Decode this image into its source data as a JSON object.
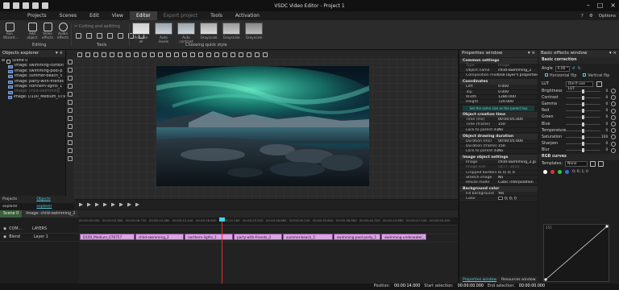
{
  "app": {
    "title": "VSDC Video Editor - Project 1",
    "options_label": "Options"
  },
  "menu": {
    "items": [
      "Projects",
      "Scenes",
      "Edit",
      "View",
      "Editor",
      "Export project",
      "Tools",
      "Activation"
    ],
    "active_index": 4
  },
  "ribbon": {
    "buttons": [
      {
        "label": "Run Wizard...",
        "icon": "wand-icon"
      },
      {
        "label": "Add object",
        "icon": "add-icon"
      },
      {
        "label": "Video effects",
        "icon": "film-icon"
      },
      {
        "label": "Audio effects",
        "icon": "headphones-icon"
      }
    ],
    "editing_group": "Editing",
    "tools_group": "Tools",
    "cutting_label": "Cutting and splitting",
    "quick_style_group": "Choosing quick style",
    "quick_styles": [
      "Remove all",
      "Auto levels",
      "Auto contrast",
      "Grayscale",
      "Grayscale",
      "Grayscale"
    ]
  },
  "objects_explorer": {
    "title": "Objects explorer",
    "scene": "Scene 0",
    "items": [
      {
        "label": "Image: swimming-cordon",
        "faded": false
      },
      {
        "label": "Image: swimming-pool-p",
        "faded": false
      },
      {
        "label": "Image: summer-beach_5",
        "faded": false
      },
      {
        "label": "Image: party-with-friends",
        "faded": false
      },
      {
        "label": "Image: northern-lights_1",
        "faded": false
      },
      {
        "label": "Image: child-swimming",
        "faded": true
      },
      {
        "label": "Image: D100_Medium_079",
        "faded": false
      }
    ],
    "tabs": [
      "Projects explorer",
      "Objects explorer"
    ]
  },
  "properties": {
    "title": "Properties window",
    "common_settings": "Common settings",
    "col_type": "Type",
    "col_image": "Image",
    "object_name_label": "Object name",
    "object_name": "child-swimming_2",
    "composition_label": "Composition mode",
    "composition": "Use layer's properties",
    "coordinates": "Coordinates",
    "left_label": "Left",
    "left": "0.000",
    "top_label": "Top",
    "top": "0.000",
    "width_label": "Width",
    "width": "1280.000",
    "height_label": "Height",
    "height": "720.000",
    "hint": "Set the same size as the parent has",
    "creation_time": "Object creation time",
    "time_ms_label": "Time (ms)",
    "time_ms": "00:00:05.000",
    "time_frame_label": "Time (frame)",
    "time_frame": "150",
    "lock_parent_label": "Lock to parent du",
    "lock_parent": "No",
    "drawing_duration": "Object drawing duration",
    "duration_ms_label": "Duration (ms)",
    "duration_ms": "00:00:05.000",
    "duration_frames_label": "Duration (frame)",
    "duration_frames": "150",
    "lock_parent2_label": "Lock to parent du",
    "lock_parent2": "No",
    "image_settings": "Image object settings",
    "image_label": "Image",
    "image": "child-swimming_2.jp",
    "image_size_label": "Image size",
    "image_size": "5477, 3655",
    "cropped_label": "Cropped borders",
    "cropped": "0; 0; 0; 0",
    "stretch_label": "Stretch image",
    "stretch": "No",
    "resize_label": "Resize mode",
    "resize": "Cubic interpolation",
    "background_color": "Background color",
    "fill_bg_label": "Fill background",
    "fill_bg": "Yes",
    "color_label": "Color",
    "color": "0; 0; 0",
    "tabs": [
      "Properties window",
      "Resources window"
    ]
  },
  "effects": {
    "title": "Basic effects window",
    "basic_correction": "Basic correction",
    "angle_label": "Angle",
    "angle_value": "0.00 °",
    "flip_h": "Horizontal flip",
    "flip_v": "Vertical flip",
    "lut_label": "LUT",
    "lut_value": "Don't use LUT",
    "sliders": [
      {
        "label": "Brightness",
        "value": "0"
      },
      {
        "label": "Contrast",
        "value": "0"
      },
      {
        "label": "Gamma",
        "value": "0"
      },
      {
        "label": "Red",
        "value": "0"
      },
      {
        "label": "Green",
        "value": "0"
      },
      {
        "label": "Blue",
        "value": "0"
      },
      {
        "label": "Temperature",
        "value": "0"
      },
      {
        "label": "Saturation",
        "value": "100"
      },
      {
        "label": "Sharpen",
        "value": "0"
      },
      {
        "label": "Blur",
        "value": "0"
      }
    ],
    "rgb_curves": "RGB curves",
    "templates_label": "Templates:",
    "templates_value": "None",
    "curve_point": "0; 0; 1; 0",
    "curve_top_label": "255",
    "colors": [
      "#ffffff",
      "#e03333",
      "#2ecc40",
      "#2f6fd8"
    ]
  },
  "timeline": {
    "tabs": [
      "Scene 0",
      "Image: child-swimming_2"
    ],
    "ticks": [
      "00:00:00.000",
      "00:00:03.360",
      "00:00:06.720",
      "00:00:10.080",
      "00:00:13.440",
      "00:00:16.800",
      "00:00:20.160",
      "00:00:23.520",
      "00:00:26.880",
      "00:00:30.240",
      "00:00:33.600",
      "00:00:36.960",
      "00:00:40.320",
      "00:00:43.680",
      "00:00:47.040",
      "00:00:50.400"
    ],
    "com_label": "COM...",
    "layers_label": "LAYERS",
    "blend_label": "Blend",
    "layer1_label": "Layer 1",
    "clips": [
      "D100_Medium_076757",
      "child-swimming_2",
      "northern-lights_1",
      "party-with-friends_4",
      "summer-beach_5",
      "swimming-pool-party_1",
      "swimming-underwater_"
    ]
  },
  "status": {
    "position_label": "Position:",
    "position": "00:00:14.000",
    "start_label": "Start selection:",
    "start": "00:00:00.000",
    "end_label": "End selection:",
    "end": "00:00:00.000"
  }
}
